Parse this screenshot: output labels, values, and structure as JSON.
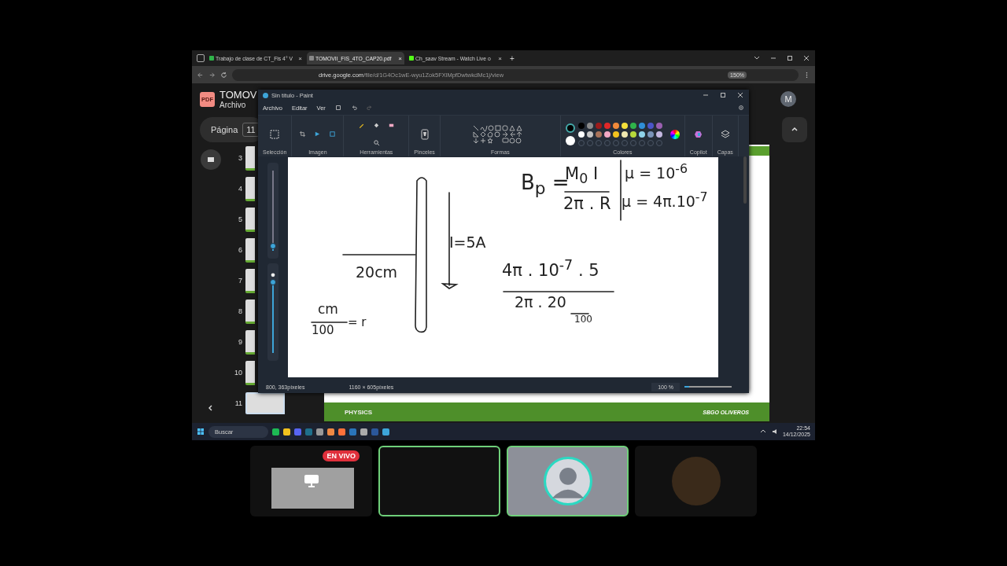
{
  "browser": {
    "tabs": [
      {
        "label": "Trabajo de clase de CT_Fis 4° V",
        "close": "×",
        "selected": false
      },
      {
        "label": "TOMOVII_FIS_4TO_CAP20.pdf",
        "close": "×",
        "selected": true
      },
      {
        "label": "Ch_saav Stream - Watch Live o",
        "close": "×",
        "selected": false
      }
    ],
    "new_tab": "+",
    "url_host": "drive.google.com",
    "url_path": "/file/d/1G4Oc1wE-wyu1Zok5FXlMpfDwtwkdMc1j/view",
    "zoom": "150%"
  },
  "pdf_viewer": {
    "badge": "PDF",
    "title": "TOMOV",
    "menu": "Archivo",
    "avatar": "M",
    "page_label": "Página",
    "page_value": "11",
    "thumbnails": [
      {
        "number": "3",
        "selected": false
      },
      {
        "number": "4",
        "selected": false
      },
      {
        "number": "5",
        "selected": false
      },
      {
        "number": "6",
        "selected": false
      },
      {
        "number": "7",
        "selected": false
      },
      {
        "number": "8",
        "selected": false
      },
      {
        "number": "9",
        "selected": false
      },
      {
        "number": "10",
        "selected": false
      },
      {
        "number": "11",
        "selected": true
      }
    ],
    "footer": "PHYSICS",
    "brand": "SBGO OLIVEROS"
  },
  "paint": {
    "title": "Sin título - Paint",
    "menu": [
      "Archivo",
      "Editar",
      "Ver"
    ],
    "groups": [
      "Selección",
      "Imagen",
      "Herramientas",
      "Pinceles",
      "Formas",
      "Colores",
      "Copilot",
      "Capas"
    ],
    "swatches": [
      {
        "color": "#000000"
      },
      {
        "color": "#8a8a8a"
      },
      {
        "color": "#9b1b1b"
      },
      {
        "color": "#e02828"
      },
      {
        "color": "#f08a3a"
      },
      {
        "color": "#f4e03a"
      },
      {
        "color": "#2fb34a"
      },
      {
        "color": "#2f8fd8"
      },
      {
        "color": "#4b55c8"
      },
      {
        "color": "#9a5fb0"
      },
      {
        "color": "#ffffff"
      },
      {
        "color": "#c4c4c4"
      },
      {
        "color": "#a8735a"
      },
      {
        "color": "#f2a8c4"
      },
      {
        "color": "#f2c21e"
      },
      {
        "color": "#efe8b0"
      },
      {
        "color": "#b6d83a"
      },
      {
        "color": "#8fd3ea"
      },
      {
        "color": "#7a94b8"
      },
      {
        "color": "#c4b8e0"
      }
    ],
    "brush_size": {
      "level": 0.05
    },
    "opacity": {
      "level": 1
    },
    "canvas_notes": [
      "B$_{p}$ =",
      "M$_{0}$ I",
      "2π . R",
      "μ = 10$^{-6}$",
      "μ = 4π.10$^{-7}$",
      "I=5A",
      "20cm",
      "4π . 10$^{-7}$ . 5",
      "2π . 20",
      "100",
      "cm",
      "100",
      "= r"
    ],
    "status": {
      "cursor": "800, 363píxeles",
      "size": "1160 × 605píxeles",
      "zoom": "100 %",
      "zoom_slider": {
        "level": 0.1
      }
    }
  },
  "taskbar": {
    "search": "Buscar",
    "time": "22:54",
    "date": "14/12/2025"
  },
  "stage": {
    "live_badge": "EN VIVO",
    "tiles": [
      {
        "kind": "screen",
        "speaking": false
      },
      {
        "kind": "blank",
        "speaking": true
      },
      {
        "kind": "avatar",
        "speaking": true
      },
      {
        "kind": "artwork",
        "speaking": false
      }
    ]
  }
}
